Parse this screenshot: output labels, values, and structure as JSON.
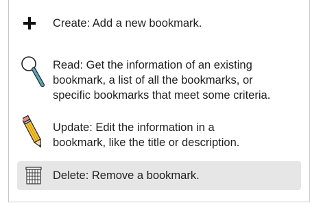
{
  "items": [
    {
      "icon": "plus-icon",
      "text": "Create: Add a new bookmark."
    },
    {
      "icon": "magnifier-icon",
      "text": "Read: Get the information of an existing\nbookmark, a list of all the bookmarks, or\nspecific bookmarks that meet some criteria."
    },
    {
      "icon": "pencil-icon",
      "text": "Update: Edit the information in a\nbookmark, like the title or description."
    },
    {
      "icon": "trash-icon",
      "text": "Delete: Remove a bookmark."
    }
  ],
  "colors": {
    "highlight_row": "#e6e6e6",
    "border": "#c8c8c8",
    "text": "#1e1e1e",
    "pencil_yellow": "#f2c232",
    "magnifier_handle": "#5aa8b8"
  }
}
